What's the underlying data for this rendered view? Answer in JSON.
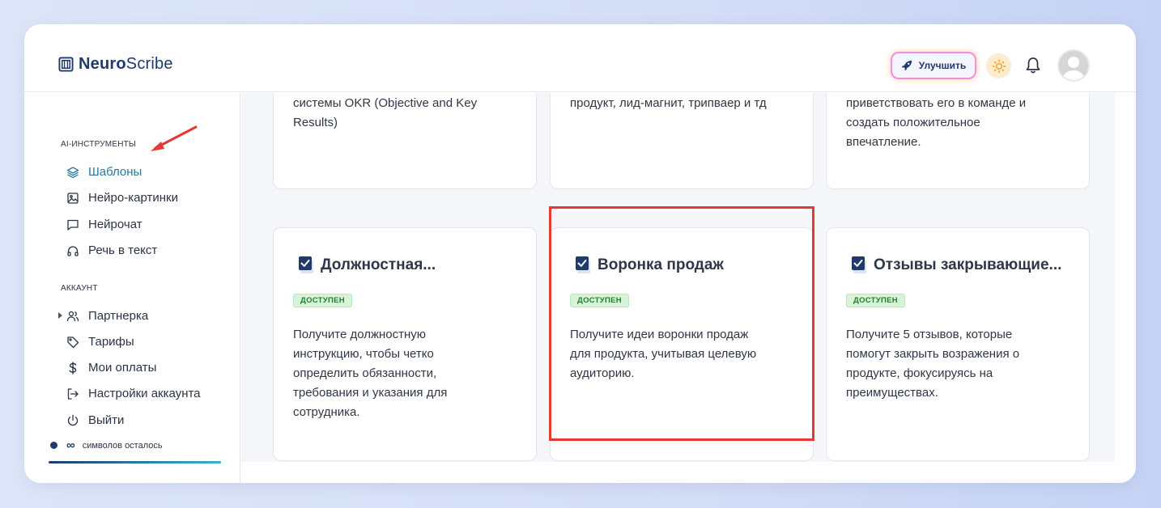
{
  "header": {
    "logo_bold": "Neuro",
    "logo_rest": "Scribe",
    "upgrade_label": "Улучшить"
  },
  "sidebar": {
    "ai_section_title": "AI-ИНСТРУМЕНТЫ",
    "ai_items": [
      {
        "label": "Шаблоны",
        "icon": "layers-icon",
        "active": true
      },
      {
        "label": "Нейро-картинки",
        "icon": "image-icon"
      },
      {
        "label": "Нейрочат",
        "icon": "chat-icon"
      },
      {
        "label": "Речь в текст",
        "icon": "headphones-icon"
      }
    ],
    "account_section_title": "АККАУНТ",
    "account_items": [
      {
        "label": "Партнерка",
        "icon": "users-icon"
      },
      {
        "label": "Тарифы",
        "icon": "tag-icon"
      },
      {
        "label": "Мои оплаты",
        "icon": "dollar-icon"
      },
      {
        "label": "Настройки аккаунта",
        "icon": "login-icon"
      },
      {
        "label": "Выйти",
        "icon": "power-icon"
      }
    ],
    "chars_symbol": "∞",
    "chars_label": "символов осталось"
  },
  "cards_top": [
    {
      "desc": "системы OKR (Objective and Key Results)"
    },
    {
      "desc": "продукт, лид-магнит, трипваер и тд"
    },
    {
      "desc": "приветствовать его в команде и создать положительное впечатление."
    }
  ],
  "cards": [
    {
      "title": "Должностная...",
      "badge": "ДОСТУПЕН",
      "desc": "Получите должностную инструкцию, чтобы четко определить обязанности, требования и указания для сотрудника."
    },
    {
      "title": "Воронка продаж",
      "badge": "ДОСТУПЕН",
      "desc": "Получите идеи воронки продаж для продукта, учитывая целевую аудиторию."
    },
    {
      "title": "Отзывы закрывающие...",
      "badge": "ДОСТУПЕН",
      "desc": "Получите 5 отзывов, которые помогут закрыть возражения о продукте, фокусируясь на преимуществах."
    }
  ],
  "colors": {
    "brand": "#1f3a6b",
    "active_nav": "#2a78a0",
    "highlight": "#e53935",
    "badge_bg": "#d6f5d8",
    "badge_text": "#277a30"
  }
}
